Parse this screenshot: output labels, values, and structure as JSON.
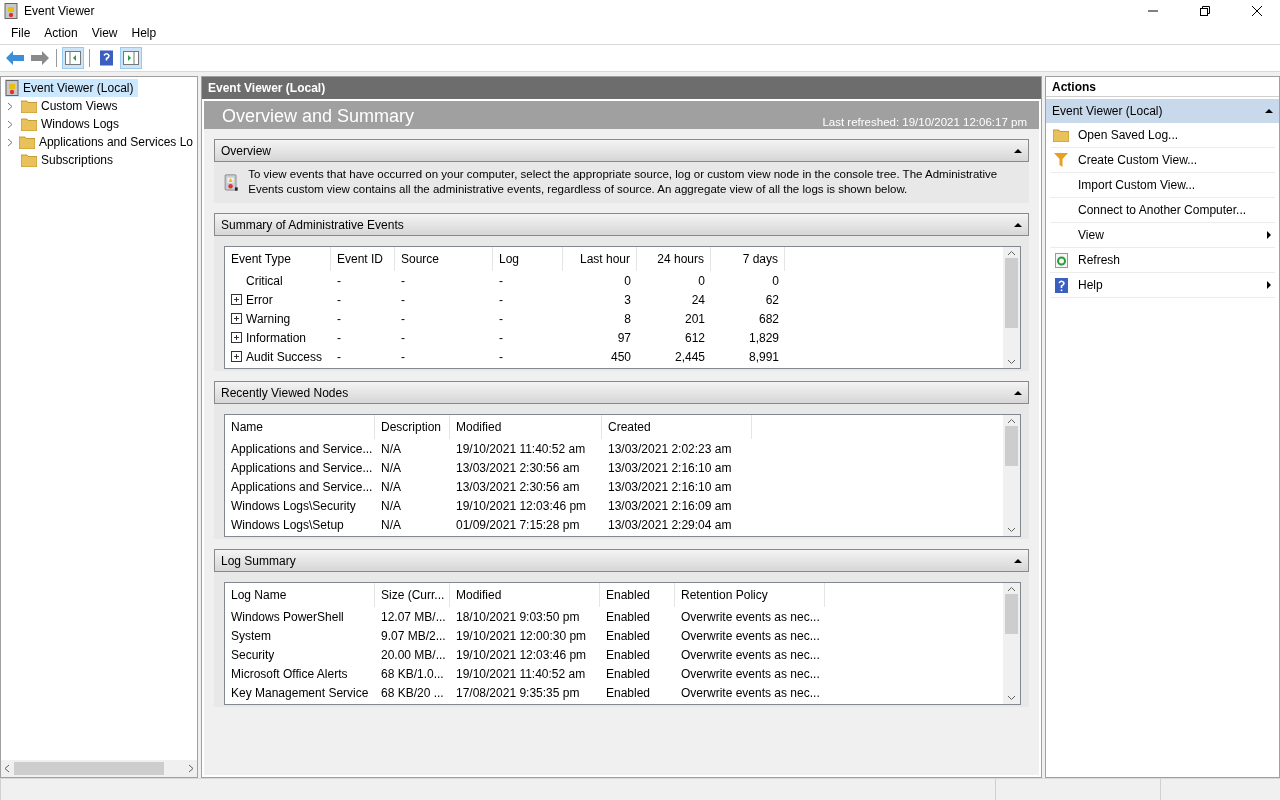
{
  "window": {
    "title": "Event Viewer"
  },
  "menu": [
    "File",
    "Action",
    "View",
    "Help"
  ],
  "tree": [
    {
      "label": "Event Viewer (Local)",
      "kind": "root",
      "expandable": false,
      "selected": true
    },
    {
      "label": "Custom Views",
      "kind": "filter-folder",
      "expandable": true,
      "selected": false
    },
    {
      "label": "Windows Logs",
      "kind": "log-folder",
      "expandable": true,
      "selected": false
    },
    {
      "label": "Applications and Services Lo",
      "kind": "folder",
      "expandable": true,
      "selected": false
    },
    {
      "label": "Subscriptions",
      "kind": "subscription",
      "expandable": false,
      "selected": false
    }
  ],
  "center": {
    "header": "Event Viewer (Local)",
    "title": "Overview and Summary",
    "last_refreshed": "Last refreshed: 19/10/2021 12:06:17 pm",
    "overview": {
      "title": "Overview",
      "text": "To view events that have occurred on your computer, select the appropriate source, log or custom view node in the console tree. The Administrative Events custom view contains all the administrative events, regardless of source. An aggregate view of all the logs is shown below."
    },
    "summary": {
      "title": "Summary of Administrative Events",
      "columns": [
        "Event Type",
        "Event ID",
        "Source",
        "Log",
        "Last hour",
        "24 hours",
        "7 days"
      ],
      "rows": [
        {
          "expandable": false,
          "cells": [
            "Critical",
            "-",
            "-",
            "-",
            "0",
            "0",
            "0"
          ]
        },
        {
          "expandable": true,
          "cells": [
            "Error",
            "-",
            "-",
            "-",
            "3",
            "24",
            "62"
          ]
        },
        {
          "expandable": true,
          "cells": [
            "Warning",
            "-",
            "-",
            "-",
            "8",
            "201",
            "682"
          ]
        },
        {
          "expandable": true,
          "cells": [
            "Information",
            "-",
            "-",
            "-",
            "97",
            "612",
            "1,829"
          ]
        },
        {
          "expandable": true,
          "cells": [
            "Audit Success",
            "-",
            "-",
            "-",
            "450",
            "2,445",
            "8,991"
          ]
        }
      ]
    },
    "recent": {
      "title": "Recently Viewed Nodes",
      "columns": [
        "Name",
        "Description",
        "Modified",
        "Created"
      ],
      "rows": [
        [
          "Applications and Service...",
          "N/A",
          "19/10/2021 11:40:52 am",
          "13/03/2021 2:02:23 am"
        ],
        [
          "Applications and Service...",
          "N/A",
          "13/03/2021 2:30:56 am",
          "13/03/2021 2:16:10 am"
        ],
        [
          "Applications and Service...",
          "N/A",
          "13/03/2021 2:30:56 am",
          "13/03/2021 2:16:10 am"
        ],
        [
          "Windows Logs\\Security",
          "N/A",
          "19/10/2021 12:03:46 pm",
          "13/03/2021 2:16:09 am"
        ],
        [
          "Windows Logs\\Setup",
          "N/A",
          "01/09/2021 7:15:28 pm",
          "13/03/2021 2:29:04 am"
        ]
      ]
    },
    "log_summary": {
      "title": "Log Summary",
      "columns": [
        "Log Name",
        "Size (Curr...",
        "Modified",
        "Enabled",
        "Retention Policy"
      ],
      "rows": [
        [
          "Windows PowerShell",
          "12.07 MB/...",
          "18/10/2021 9:03:50 pm",
          "Enabled",
          "Overwrite events as nec..."
        ],
        [
          "System",
          "9.07 MB/2...",
          "19/10/2021 12:00:30 pm",
          "Enabled",
          "Overwrite events as nec..."
        ],
        [
          "Security",
          "20.00 MB/...",
          "19/10/2021 12:03:46 pm",
          "Enabled",
          "Overwrite events as nec..."
        ],
        [
          "Microsoft Office Alerts",
          "68 KB/1.0...",
          "19/10/2021 11:40:52 am",
          "Enabled",
          "Overwrite events as nec..."
        ],
        [
          "Key Management Service",
          "68 KB/20 ...",
          "17/08/2021 9:35:35 pm",
          "Enabled",
          "Overwrite events as nec..."
        ]
      ]
    }
  },
  "actions": {
    "title": "Actions",
    "group": "Event Viewer (Local)",
    "items": [
      {
        "label": "Open Saved Log...",
        "kind": "folder",
        "submenu": false
      },
      {
        "label": "Create Custom View...",
        "kind": "filter",
        "submenu": false
      },
      {
        "label": "Import Custom View...",
        "kind": "plain",
        "submenu": false
      },
      {
        "label": "Connect to Another Computer...",
        "kind": "plain",
        "submenu": false
      },
      {
        "label": "View",
        "kind": "plain",
        "submenu": true
      },
      {
        "label": "Refresh",
        "kind": "refresh",
        "submenu": false
      },
      {
        "label": "Help",
        "kind": "help",
        "submenu": true
      }
    ]
  }
}
